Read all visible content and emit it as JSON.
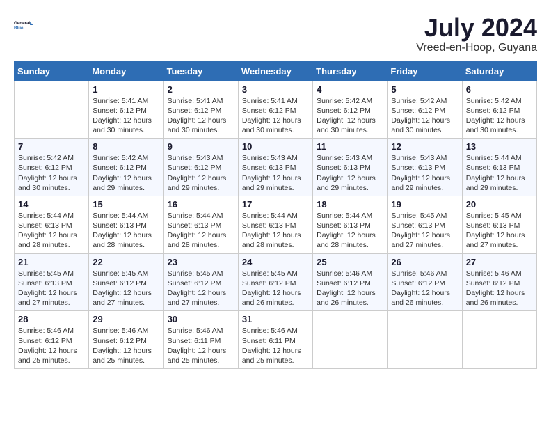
{
  "header": {
    "logo_line1": "General",
    "logo_line2": "Blue",
    "month_year": "July 2024",
    "location": "Vreed-en-Hoop, Guyana"
  },
  "days_of_week": [
    "Sunday",
    "Monday",
    "Tuesday",
    "Wednesday",
    "Thursday",
    "Friday",
    "Saturday"
  ],
  "weeks": [
    [
      {
        "num": "",
        "info": ""
      },
      {
        "num": "1",
        "info": "Sunrise: 5:41 AM\nSunset: 6:12 PM\nDaylight: 12 hours\nand 30 minutes."
      },
      {
        "num": "2",
        "info": "Sunrise: 5:41 AM\nSunset: 6:12 PM\nDaylight: 12 hours\nand 30 minutes."
      },
      {
        "num": "3",
        "info": "Sunrise: 5:41 AM\nSunset: 6:12 PM\nDaylight: 12 hours\nand 30 minutes."
      },
      {
        "num": "4",
        "info": "Sunrise: 5:42 AM\nSunset: 6:12 PM\nDaylight: 12 hours\nand 30 minutes."
      },
      {
        "num": "5",
        "info": "Sunrise: 5:42 AM\nSunset: 6:12 PM\nDaylight: 12 hours\nand 30 minutes."
      },
      {
        "num": "6",
        "info": "Sunrise: 5:42 AM\nSunset: 6:12 PM\nDaylight: 12 hours\nand 30 minutes."
      }
    ],
    [
      {
        "num": "7",
        "info": "Sunrise: 5:42 AM\nSunset: 6:12 PM\nDaylight: 12 hours\nand 30 minutes."
      },
      {
        "num": "8",
        "info": "Sunrise: 5:42 AM\nSunset: 6:12 PM\nDaylight: 12 hours\nand 29 minutes."
      },
      {
        "num": "9",
        "info": "Sunrise: 5:43 AM\nSunset: 6:12 PM\nDaylight: 12 hours\nand 29 minutes."
      },
      {
        "num": "10",
        "info": "Sunrise: 5:43 AM\nSunset: 6:13 PM\nDaylight: 12 hours\nand 29 minutes."
      },
      {
        "num": "11",
        "info": "Sunrise: 5:43 AM\nSunset: 6:13 PM\nDaylight: 12 hours\nand 29 minutes."
      },
      {
        "num": "12",
        "info": "Sunrise: 5:43 AM\nSunset: 6:13 PM\nDaylight: 12 hours\nand 29 minutes."
      },
      {
        "num": "13",
        "info": "Sunrise: 5:44 AM\nSunset: 6:13 PM\nDaylight: 12 hours\nand 29 minutes."
      }
    ],
    [
      {
        "num": "14",
        "info": "Sunrise: 5:44 AM\nSunset: 6:13 PM\nDaylight: 12 hours\nand 28 minutes."
      },
      {
        "num": "15",
        "info": "Sunrise: 5:44 AM\nSunset: 6:13 PM\nDaylight: 12 hours\nand 28 minutes."
      },
      {
        "num": "16",
        "info": "Sunrise: 5:44 AM\nSunset: 6:13 PM\nDaylight: 12 hours\nand 28 minutes."
      },
      {
        "num": "17",
        "info": "Sunrise: 5:44 AM\nSunset: 6:13 PM\nDaylight: 12 hours\nand 28 minutes."
      },
      {
        "num": "18",
        "info": "Sunrise: 5:44 AM\nSunset: 6:13 PM\nDaylight: 12 hours\nand 28 minutes."
      },
      {
        "num": "19",
        "info": "Sunrise: 5:45 AM\nSunset: 6:13 PM\nDaylight: 12 hours\nand 27 minutes."
      },
      {
        "num": "20",
        "info": "Sunrise: 5:45 AM\nSunset: 6:13 PM\nDaylight: 12 hours\nand 27 minutes."
      }
    ],
    [
      {
        "num": "21",
        "info": "Sunrise: 5:45 AM\nSunset: 6:13 PM\nDaylight: 12 hours\nand 27 minutes."
      },
      {
        "num": "22",
        "info": "Sunrise: 5:45 AM\nSunset: 6:12 PM\nDaylight: 12 hours\nand 27 minutes."
      },
      {
        "num": "23",
        "info": "Sunrise: 5:45 AM\nSunset: 6:12 PM\nDaylight: 12 hours\nand 27 minutes."
      },
      {
        "num": "24",
        "info": "Sunrise: 5:45 AM\nSunset: 6:12 PM\nDaylight: 12 hours\nand 26 minutes."
      },
      {
        "num": "25",
        "info": "Sunrise: 5:46 AM\nSunset: 6:12 PM\nDaylight: 12 hours\nand 26 minutes."
      },
      {
        "num": "26",
        "info": "Sunrise: 5:46 AM\nSunset: 6:12 PM\nDaylight: 12 hours\nand 26 minutes."
      },
      {
        "num": "27",
        "info": "Sunrise: 5:46 AM\nSunset: 6:12 PM\nDaylight: 12 hours\nand 26 minutes."
      }
    ],
    [
      {
        "num": "28",
        "info": "Sunrise: 5:46 AM\nSunset: 6:12 PM\nDaylight: 12 hours\nand 25 minutes."
      },
      {
        "num": "29",
        "info": "Sunrise: 5:46 AM\nSunset: 6:12 PM\nDaylight: 12 hours\nand 25 minutes."
      },
      {
        "num": "30",
        "info": "Sunrise: 5:46 AM\nSunset: 6:11 PM\nDaylight: 12 hours\nand 25 minutes."
      },
      {
        "num": "31",
        "info": "Sunrise: 5:46 AM\nSunset: 6:11 PM\nDaylight: 12 hours\nand 25 minutes."
      },
      {
        "num": "",
        "info": ""
      },
      {
        "num": "",
        "info": ""
      },
      {
        "num": "",
        "info": ""
      }
    ]
  ]
}
